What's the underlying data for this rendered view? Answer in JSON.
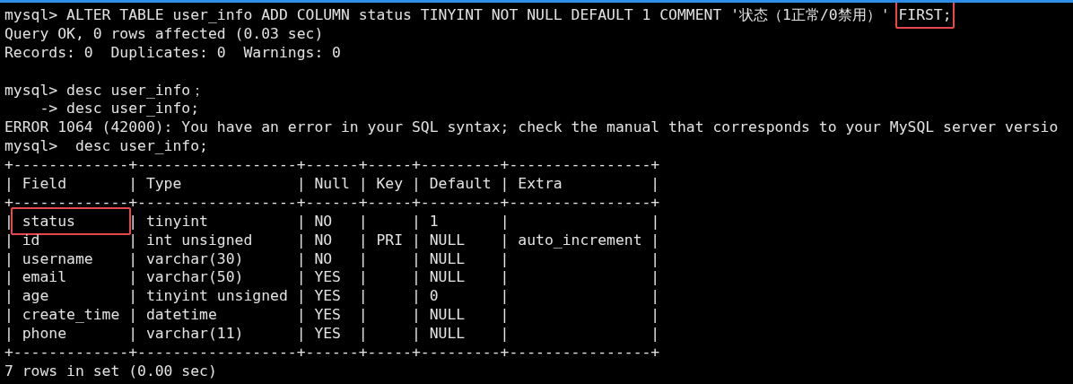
{
  "terminal": {
    "lines": [
      {
        "kind": "text",
        "segments": [
          {
            "text": "mysql> ALTER TABLE user_info ADD COLUMN status TINYINT NOT NULL DEFAULT 1 COMMENT '状态（1正常/0禁用）' ",
            "highlighted": false
          },
          {
            "text": "FIRST;",
            "highlighted": true
          }
        ]
      },
      {
        "kind": "text",
        "segments": [
          {
            "text": "Query OK, 0 rows affected (0.03 sec)",
            "highlighted": false
          }
        ]
      },
      {
        "kind": "text",
        "segments": [
          {
            "text": "Records: 0  Duplicates: 0  Warnings: 0",
            "highlighted": false
          }
        ]
      },
      {
        "kind": "blank"
      },
      {
        "kind": "text",
        "segments": [
          {
            "text": "mysql> desc user_info；",
            "highlighted": false
          }
        ]
      },
      {
        "kind": "text",
        "segments": [
          {
            "text": "    -> desc user_info;",
            "highlighted": false
          }
        ]
      },
      {
        "kind": "text",
        "segments": [
          {
            "text": "ERROR 1064 (42000): You have an error in your SQL syntax; check the manual that corresponds to your MySQL server versio",
            "highlighted": false
          }
        ]
      },
      {
        "kind": "text",
        "segments": [
          {
            "text": "mysql>  desc user_info;",
            "highlighted": false
          }
        ]
      },
      {
        "kind": "text",
        "segments": [
          {
            "text": "+-------------+------------------+------+-----+---------+----------------+",
            "highlighted": false
          }
        ]
      },
      {
        "kind": "text",
        "segments": [
          {
            "text": "| Field       | Type             | Null | Key | Default | Extra          |",
            "highlighted": false
          }
        ]
      },
      {
        "kind": "text",
        "segments": [
          {
            "text": "+-------------+------------------+------+-----+---------+----------------+",
            "highlighted": false
          }
        ]
      },
      {
        "kind": "text",
        "segments": [
          {
            "text": "|",
            "highlighted": false
          },
          {
            "text": " status      ",
            "highlighted": true
          },
          {
            "text": "| tinyint          | NO   |     | 1       |                |",
            "highlighted": false
          }
        ]
      },
      {
        "kind": "text",
        "segments": [
          {
            "text": "| id          | int unsigned     | NO   | PRI | NULL    | auto_increment |",
            "highlighted": false
          }
        ]
      },
      {
        "kind": "text",
        "segments": [
          {
            "text": "| username    | varchar(30)      | NO   |     | NULL    |                |",
            "highlighted": false
          }
        ]
      },
      {
        "kind": "text",
        "segments": [
          {
            "text": "| email       | varchar(50)      | YES  |     | NULL    |                |",
            "highlighted": false
          }
        ]
      },
      {
        "kind": "text",
        "segments": [
          {
            "text": "| age         | tinyint unsigned | YES  |     | 0       |                |",
            "highlighted": false
          }
        ]
      },
      {
        "kind": "text",
        "segments": [
          {
            "text": "| create_time | datetime         | YES  |     | NULL    |                |",
            "highlighted": false
          }
        ]
      },
      {
        "kind": "text",
        "segments": [
          {
            "text": "| phone       | varchar(11)      | YES  |     | NULL    |                |",
            "highlighted": false
          }
        ]
      },
      {
        "kind": "text",
        "segments": [
          {
            "text": "+-------------+------------------+------+-----+---------+----------------+",
            "highlighted": false
          }
        ]
      },
      {
        "kind": "text",
        "segments": [
          {
            "text": "7 rows in set (0.00 sec)",
            "highlighted": false
          }
        ]
      }
    ]
  }
}
